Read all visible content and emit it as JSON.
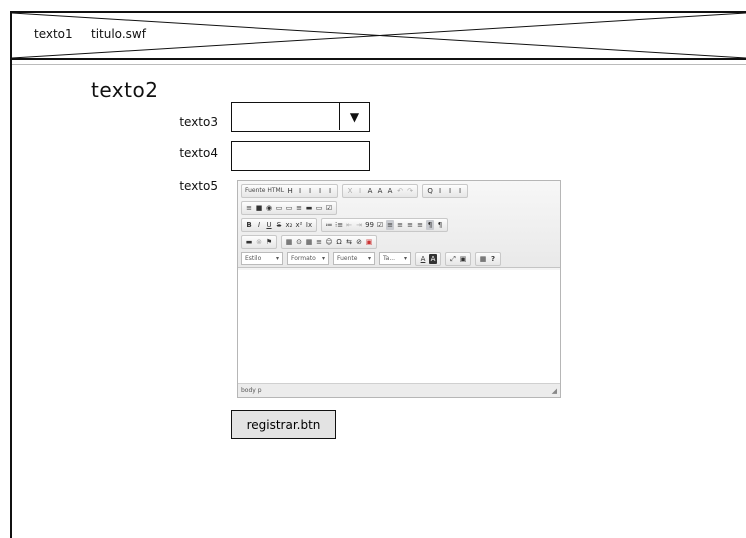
{
  "header": {
    "text1": "texto1",
    "text2": "titulo.swf"
  },
  "main": {
    "title": "texto2",
    "fields": {
      "label3": "texto3",
      "label4": "texto4",
      "label5": "texto5",
      "combo_arrow": "▼",
      "input_value": ""
    },
    "editor": {
      "row1": {
        "source": "Fuente HTML",
        "items": [
          "H",
          "I",
          "I",
          "I",
          "I",
          "X",
          "I",
          "A",
          "A",
          "A",
          "↶",
          "↷",
          "Q",
          "I",
          "I",
          "I"
        ]
      },
      "row2": [
        "≡",
        "■",
        "◉",
        "▭",
        "▭",
        "≡",
        "▬",
        "▭",
        "☑"
      ],
      "row3": {
        "bold": "B",
        "italic": "I",
        "underline": "U",
        "strike": "S",
        "subscript": "x₂",
        "superscript": "x²",
        "clear": "Ix",
        "numlist": "≔",
        "bullist": "⁝≡",
        "outdent": "⇤",
        "indent": "⇥",
        "quote": "99",
        "div": "☑",
        "align_left": "≡",
        "align_center": "≡",
        "align_right": "≡",
        "align_justify": "≡",
        "ltr": "¶",
        "rtl": "¶"
      },
      "row4": [
        "▬",
        "⊗",
        "⚑",
        "▦",
        "⊙",
        "▦",
        "≡",
        "☺",
        "Ω",
        "⇆",
        "⊘",
        "▣"
      ],
      "row5": {
        "style": "Estilo",
        "format": "Formato",
        "font": "Fuente",
        "size": "Ta...",
        "text_color": "A",
        "bg_color": "A",
        "maximize": "⤢",
        "blocks": "▣",
        "about": "▦",
        "help": "?"
      },
      "status_path": "body  p",
      "content": ""
    },
    "button_label": "registrar.btn"
  },
  "colors": {
    "frame": "#111111",
    "button_bg": "#e3e3e3",
    "editor_toolbar": "#ebebeb"
  }
}
